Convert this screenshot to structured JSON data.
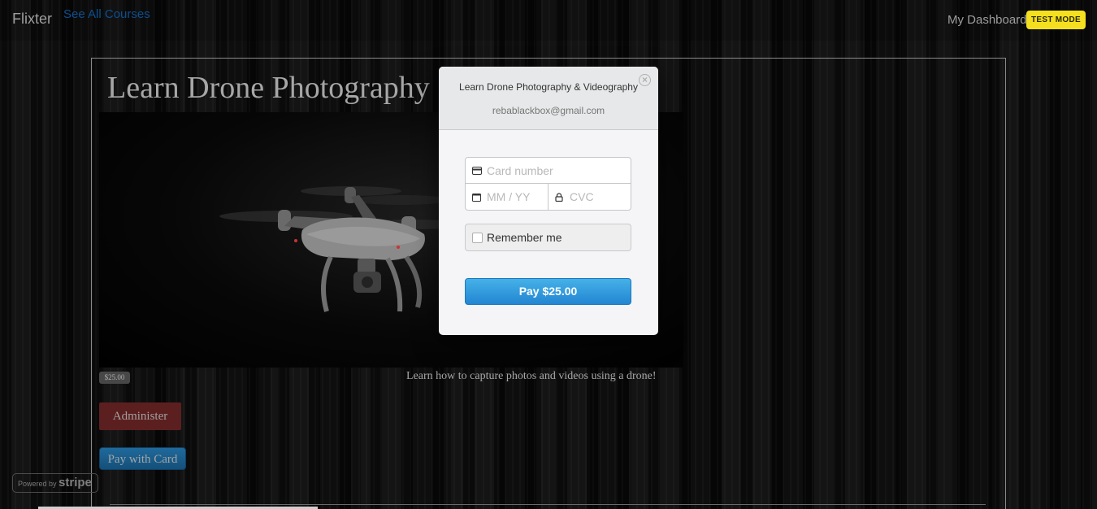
{
  "navbar": {
    "brand": "Flixter",
    "see_all_courses": "See All Courses",
    "my_dashboard": "My Dashboard",
    "test_mode_badge": "TEST MODE"
  },
  "course": {
    "title": "Learn Drone Photography",
    "price_badge": "$25.00",
    "description": "Learn how to capture photos and videos using a drone!",
    "administer_label": "Administer",
    "pay_with_card_label": "Pay with Card"
  },
  "stripe_badge": {
    "powered_by": "Powered by",
    "brand": "stripe"
  },
  "checkout": {
    "item_name": "Learn Drone Photography & Videography",
    "email": "rebablackbox@gmail.com",
    "card_number_placeholder": "Card number",
    "expiry_placeholder": "MM / YY",
    "cvc_placeholder": "CVC",
    "remember_me_label": "Remember me",
    "pay_button_label": "Pay $25.00"
  },
  "colors": {
    "test_mode": "#f5e01f",
    "pay_button": "#2e96dc",
    "administer": "#5c1f1f",
    "link": "#0d4f8f"
  },
  "icons": [
    "close-icon",
    "credit-card-icon",
    "calendar-icon",
    "lock-icon",
    "drone-image"
  ]
}
